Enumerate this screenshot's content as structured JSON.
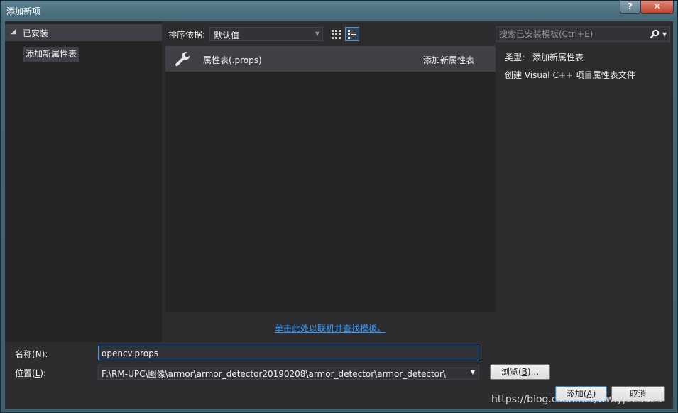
{
  "window": {
    "title": "添加新项",
    "help_label": "?",
    "close_label": "✕"
  },
  "tree": {
    "header": "已安装",
    "items": [
      {
        "label": "添加新属性表"
      }
    ]
  },
  "toolbar": {
    "sort_label": "排序依据:",
    "sort_value": "默认值",
    "search_placeholder": "搜索已安装模板(Ctrl+E)"
  },
  "templates": [
    {
      "name": "属性表(.props)",
      "category": "添加新属性表",
      "icon": "wrench-icon"
    }
  ],
  "details": {
    "type_label": "类型:",
    "type_value": "添加新属性表",
    "description": "创建 Visual C++ 项目属性表文件"
  },
  "online_link": "单击此处以联机并查找模板。",
  "form": {
    "name_label_pre": "名称(",
    "name_label_key": "N",
    "name_label_post": "):",
    "name_value": "opencv.props",
    "location_label_pre": "位置(",
    "location_label_key": "L",
    "location_label_post": "):",
    "location_value": "F:\\RM-UPC\\图像\\armor\\armor_detector20190208\\armor_detector\\armor_detector\\",
    "browse_pre": "浏览(",
    "browse_key": "B",
    "browse_post": ")...",
    "add_pre": "添加(",
    "add_key": "A",
    "add_post": ")",
    "cancel": "取消"
  },
  "watermark": "https://blog.csdn.net/wwlyj123321",
  "colors": {
    "accent": "#3399ff",
    "panel": "#2d2d30",
    "list_bg": "#252526",
    "selected": "#3f3f46"
  }
}
